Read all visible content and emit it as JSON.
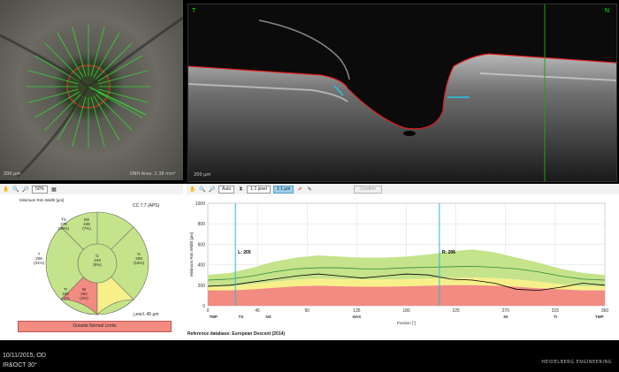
{
  "fundus": {
    "scale": "200 µm",
    "magnification": "ONH Area: 2.38 mm²"
  },
  "oct": {
    "left_marker": "T",
    "right_marker": "N",
    "scale": "200 µm"
  },
  "left_toolbar": {
    "zoom_value": "50%"
  },
  "right_toolbar": {
    "zoom_mode": "Auto",
    "ratio_1": "1:1 pixel",
    "ratio_2": "1:1 µm",
    "confirm": "Confirm"
  },
  "chart_title": "Minimum Rim Width [µm]",
  "circle_label": "CC 7.7 (APS)",
  "sectors": {
    "TS": {
      "name": "TS",
      "value": "278",
      "pct": "(39%)"
    },
    "NS": {
      "name": "NS",
      "value": "249",
      "pct": "(7%)"
    },
    "T": {
      "name": "T",
      "value": "208",
      "pct": "(31%)"
    },
    "G": {
      "name": "G",
      "value": "243",
      "pct": "(8%)"
    },
    "N": {
      "name": "N",
      "value": "208",
      "pct": "(15%)"
    },
    "TI": {
      "name": "TI",
      "value": "158",
      "pct": "<1%"
    },
    "NI": {
      "name": "NI",
      "value": "264",
      "pct": "(4%)"
    }
  },
  "excl_label": "excl. 45 µm",
  "outside_label": "Outside Normal Limits",
  "reference": "Reference database: European Descent (2014)",
  "chart_data": {
    "type": "line",
    "ylabel": "Minimum Rim Width [µm]",
    "xlabel": "Position [°]",
    "ylim": [
      0,
      1000
    ],
    "xlim": [
      0,
      360
    ],
    "yticks": [
      "0",
      "200",
      "400",
      "600",
      "800",
      "1000"
    ],
    "xticks": [
      "0",
      "45",
      "90",
      "135",
      "180",
      "225",
      "270",
      "315",
      "360"
    ],
    "sector_labels": [
      "TMP",
      "TS",
      "NS",
      "NAS",
      "NI",
      "TI",
      "TMP"
    ],
    "markers": [
      {
        "label": "L: 205",
        "x": 25
      },
      {
        "label": "R: 206",
        "x": 210
      }
    ],
    "series": [
      {
        "name": "",
        "color": "#000000",
        "x": [
          0,
          20,
          40,
          60,
          80,
          100,
          120,
          140,
          160,
          180,
          200,
          220,
          240,
          260,
          280,
          300,
          320,
          340,
          360
        ],
        "y": [
          190,
          200,
          230,
          260,
          290,
          310,
          290,
          270,
          290,
          310,
          300,
          260,
          250,
          220,
          160,
          150,
          180,
          220,
          200
        ]
      },
      {
        "name": "",
        "color": "#2a8a3a",
        "x": [
          0,
          20,
          40,
          60,
          80,
          100,
          120,
          140,
          160,
          180,
          200,
          220,
          240,
          260,
          280,
          300,
          320,
          340,
          360
        ],
        "y": [
          250,
          260,
          290,
          330,
          360,
          370,
          370,
          360,
          360,
          370,
          375,
          380,
          385,
          375,
          360,
          330,
          290,
          260,
          250
        ]
      }
    ],
    "bands": {
      "x": [
        0,
        20,
        40,
        60,
        80,
        100,
        120,
        140,
        160,
        180,
        200,
        220,
        240,
        260,
        280,
        300,
        320,
        340,
        360
      ],
      "red_top": [
        150,
        150,
        160,
        175,
        190,
        195,
        190,
        185,
        185,
        190,
        195,
        200,
        200,
        195,
        185,
        170,
        160,
        150,
        150
      ],
      "yellow_top": [
        185,
        190,
        210,
        235,
        255,
        265,
        260,
        255,
        255,
        260,
        265,
        270,
        275,
        270,
        255,
        235,
        210,
        190,
        185
      ],
      "green_top": [
        300,
        320,
        370,
        430,
        470,
        490,
        480,
        470,
        470,
        480,
        500,
        530,
        550,
        520,
        470,
        420,
        360,
        320,
        300
      ]
    }
  }
}
